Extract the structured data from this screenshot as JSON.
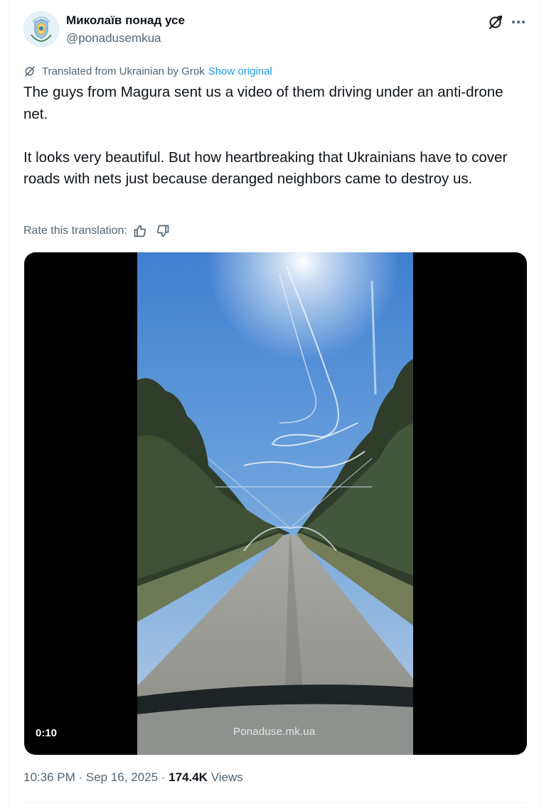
{
  "author": {
    "display_name": "Миколаїв понад усе",
    "handle": "@ponadusemkua",
    "avatar_icon": "city-emblem-avatar",
    "avatar_text": "МИКОЛАЇВ ПОНАД УСЕ"
  },
  "header_actions": {
    "grok_icon": "grok-icon",
    "more_icon": "more-icon"
  },
  "translation": {
    "label": "Translated from Ukrainian by Grok",
    "show_original": "Show original"
  },
  "tweet": {
    "text": "The guys from Magura sent us a video of them driving under an anti-drone net.\n\nIt looks very beautiful. But how heartbreaking that Ukrainians have to cover roads with nets just because deranged neighbors came to destroy us."
  },
  "rating": {
    "label": "Rate this translation:",
    "thumbs_up_icon": "thumbs-up-icon",
    "thumbs_down_icon": "thumbs-down-icon"
  },
  "media": {
    "duration": "0:10",
    "watermark": "Ponaduse.mk.ua"
  },
  "meta": {
    "time": "10:36 PM",
    "separator": " · ",
    "date": "Sep 16, 2025",
    "views_count": "174.4K",
    "views_label": " Views"
  },
  "colors": {
    "accent": "#1d9bf0",
    "text_primary": "#0f1419",
    "text_secondary": "#536471",
    "border": "#eff3f4"
  }
}
